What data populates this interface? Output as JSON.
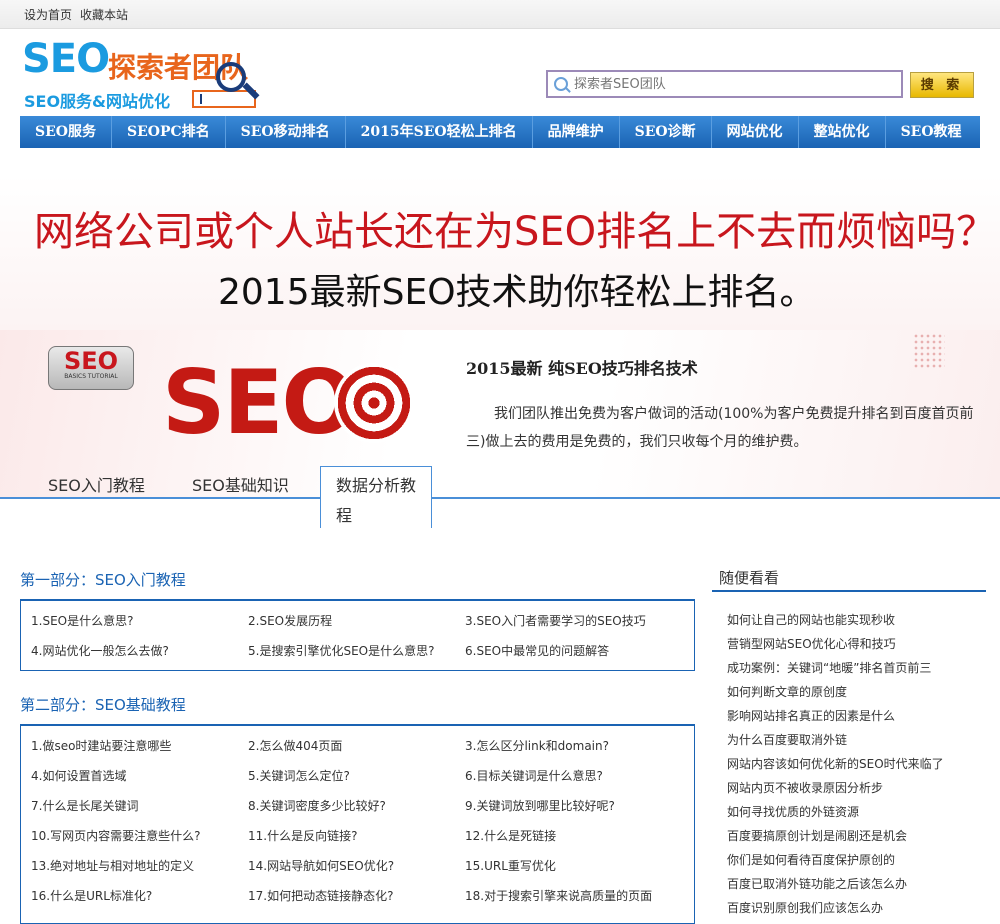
{
  "topbar": {
    "set_home": "设为首页",
    "bookmark": "收藏本站"
  },
  "logo": {
    "line1_a": "SEO",
    "line1_b": "探索者团队",
    "line2": "SEO服务&网站优化"
  },
  "search": {
    "placeholder": "探索者SEO团队",
    "button": "搜 索"
  },
  "nav": [
    "SEO服务",
    "SEOPC排名",
    "SEO移动排名",
    "2015年SEO轻松上排名",
    "品牌维护",
    "SEO诊断",
    "网站优化",
    "整站优化",
    "SEO教程"
  ],
  "banner": {
    "headline": "网络公司或个人站长还在为SEO排名上不去而烦恼吗？",
    "subheadline": "2015最新SEO技术助你轻松上排名。",
    "badge_big": "SEO",
    "badge_small": "BASICS TUTORIAL",
    "big_seo": "SEO",
    "title": "2015最新  纯SEO技巧排名技术",
    "description": "我们团队推出免费为客户做词的活动(100%为客户免费提升排名到百度首页前三)做上去的费用是免费的，我们只收每个月的维护费。"
  },
  "tabs": [
    "SEO入门教程",
    "SEO基础知识",
    "数据分析教程"
  ],
  "sections": [
    {
      "title": "第一部分：SEO入门教程",
      "rows": [
        [
          "1.SEO是什么意思?",
          "2.SEO发展历程",
          "3.SEO入门者需要学习的SEO技巧"
        ],
        [
          "4.网站优化一般怎么去做?",
          "5.是搜索引擎优化SEO是什么意思?",
          "6.SEO中最常见的问题解答"
        ]
      ]
    },
    {
      "title": "第二部分：SEO基础教程",
      "rows": [
        [
          "1.做seo时建站要注意哪些",
          "2.怎么做404页面",
          "3.怎么区分link和domain?"
        ],
        [
          "4.如何设置首选域",
          "5.关键词怎么定位?",
          "6.目标关键词是什么意思?"
        ],
        [
          "7.什么是长尾关键词",
          "8.关键词密度多少比较好?",
          "9.关键词放到哪里比较好呢?"
        ],
        [
          "10.写网页内容需要注意些什么?",
          "11.什么是反向链接?",
          "12.什么是死链接"
        ],
        [
          "13.绝对地址与相对地址的定义",
          "14.网站导航如何SEO优化?",
          "15.URL重写优化"
        ],
        [
          "16.什么是URL标准化?",
          "17.如何把动态链接静态化?",
          "18.对于搜索引擎来说高质量的页面"
        ]
      ]
    }
  ],
  "sidebar": {
    "title": "随便看看",
    "items": [
      "如何让自己的网站也能实现秒收",
      "营销型网站SEO优化心得和技巧",
      "成功案例：关键词“地暖”排名首页前三",
      "如何判断文章的原创度",
      "影响网站排名真正的因素是什么",
      "为什么百度要取消外链",
      "网站内容该如何优化新的SEO时代来临了",
      "网站内页不被收录原因分析步",
      "如何寻找优质的外链资源",
      "百度要搞原创计划是闹剧还是机会",
      "你们是如何看待百度保护原创的",
      "百度已取消外链功能之后该怎么办",
      "百度识别原创我们应该怎么办"
    ]
  }
}
